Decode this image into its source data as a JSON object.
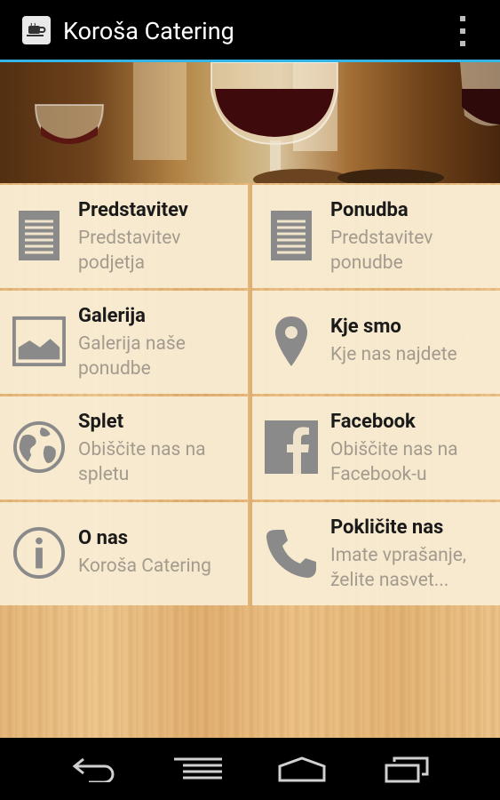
{
  "app": {
    "title": "Koroša Catering",
    "accent_color": "#33b5e5",
    "icon": "coffee-cup-icon"
  },
  "tiles": [
    {
      "title": "Predstavitev",
      "subtitle": "Predstavitev podjetja",
      "icon": "document-icon"
    },
    {
      "title": "Ponudba",
      "subtitle": "Predstavitev ponudbe",
      "icon": "document-icon"
    },
    {
      "title": "Galerija",
      "subtitle": "Galerija naše ponudbe",
      "icon": "image-icon"
    },
    {
      "title": "Kje smo",
      "subtitle": "Kje nas najdete",
      "icon": "location-pin-icon"
    },
    {
      "title": "Splet",
      "subtitle": "Obiščite nas na spletu",
      "icon": "globe-icon"
    },
    {
      "title": "Facebook",
      "subtitle": "Obiščite nas na Facebook-u",
      "icon": "facebook-icon"
    },
    {
      "title": "O nas",
      "subtitle": "Koroša Catering",
      "icon": "info-icon"
    },
    {
      "title": "Pokličite nas",
      "subtitle": "Imate vprašanje, želite nasvet...",
      "icon": "phone-icon"
    }
  ],
  "navbar": {
    "buttons": [
      "back-icon",
      "recent-menu-icon",
      "home-icon",
      "recent-apps-icon"
    ]
  }
}
